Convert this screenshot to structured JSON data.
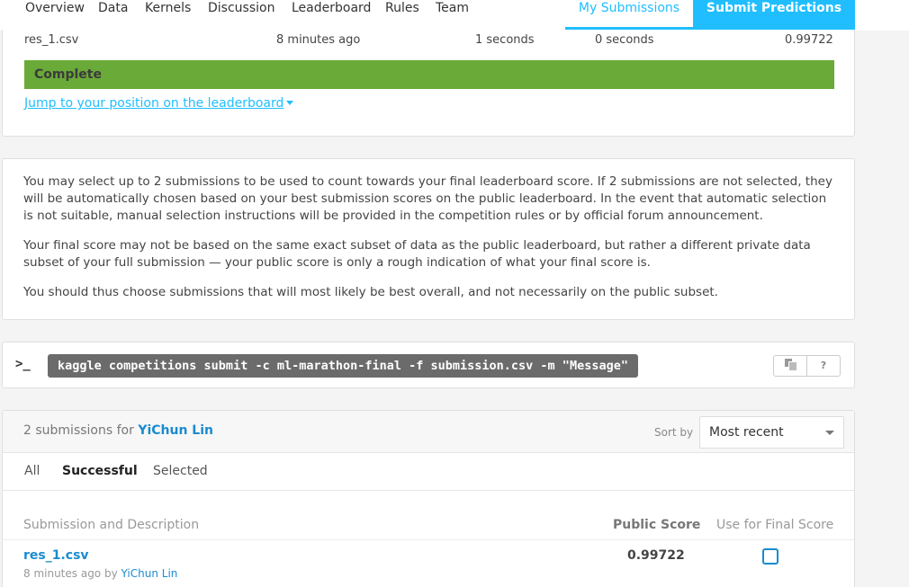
{
  "nav": {
    "tabs": [
      "Overview",
      "Data",
      "Kernels",
      "Discussion",
      "Leaderboard",
      "Rules",
      "Team"
    ],
    "my_submissions": "My Submissions",
    "submit_predictions": "Submit Predictions"
  },
  "latest": {
    "file": "res_1.csv",
    "submitted": "8 minutes ago",
    "wait_time": "1 seconds",
    "exec_time": "0 seconds",
    "score": "0.99722",
    "status": "Complete",
    "jump_link": "Jump to your position on the leaderboard"
  },
  "info": {
    "p1": "You may select up to 2 submissions to be used to count towards your final leaderboard score. If 2 submissions are not selected, they will be automatically chosen based on your best submission scores on the public leaderboard. In the event that automatic selection is not suitable, manual selection instructions will be provided in the competition rules or by official forum announcement.",
    "p2": "Your final score may not be based on the same exact subset of data as the public leaderboard, but rather a different private data subset of your full submission — your public score is only a rough indication of what your final score is.",
    "p3": "You should thus choose submissions that will most likely be best overall, and not necessarily on the public subset."
  },
  "api": {
    "prompt": ">_",
    "command": "kaggle competitions submit -c ml-marathon-final -f submission.csv -m \"Message\"",
    "help": "?"
  },
  "submissions": {
    "count_text": "2 submissions for",
    "user": "YiChun Lin",
    "sort_label": "Sort by",
    "sort_value": "Most recent",
    "filters": [
      "All",
      "Successful",
      "Selected"
    ],
    "active_filter": "Successful",
    "columns": {
      "desc": "Submission and Description",
      "public_score": "Public Score",
      "final": "Use for Final Score"
    },
    "rows": [
      {
        "file": "res_1.csv",
        "meta_prefix": "8 minutes ago by",
        "user": "YiChun Lin",
        "score": "0.99722",
        "selected": false
      }
    ]
  }
}
